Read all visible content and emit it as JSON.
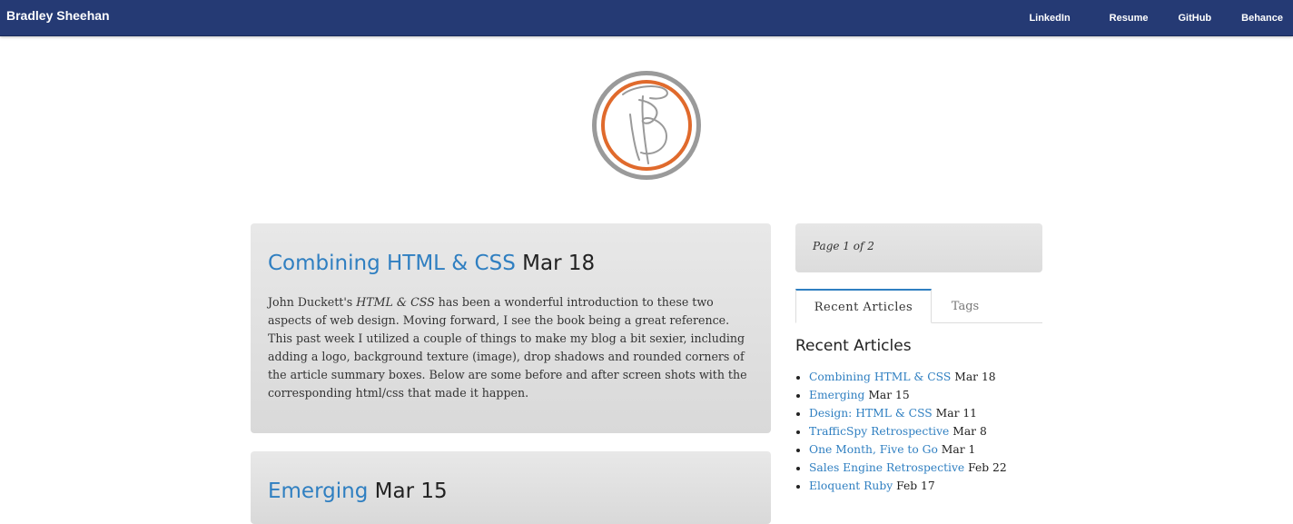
{
  "navbar": {
    "brand": "Bradley Sheehan",
    "links": [
      "LinkedIn",
      "Resume",
      "GitHub",
      "Behance"
    ]
  },
  "colors": {
    "navbar_bg": "#253a74",
    "link": "#2f7fc1",
    "logo_orange": "#e06a2c",
    "logo_gray": "#9a9a9a"
  },
  "logo": {
    "icon": "bs-monogram-logo"
  },
  "posts": [
    {
      "title": "Combining HTML & CSS",
      "date": "Mar 18",
      "excerpt_before": "John Duckett's ",
      "excerpt_book": "HTML & CSS",
      "excerpt_after": " has been a wonderful introduction to these two aspects of web design. Moving forward, I see the book being a great reference. This past week I utilized a couple of things to make my blog a bit sexier, including adding a logo, background texture (image), drop shadows and rounded corners of the article summary boxes. Below are some before and after screen shots with the corresponding html/css that made it happen."
    },
    {
      "title": "Emerging",
      "date": "Mar 15"
    }
  ],
  "sidebar": {
    "pagination": "Page 1 of 2",
    "tabs": [
      "Recent Articles",
      "Tags"
    ],
    "heading": "Recent Articles",
    "recent": [
      {
        "title": "Combining HTML & CSS",
        "date": "Mar 18"
      },
      {
        "title": "Emerging",
        "date": "Mar 15"
      },
      {
        "title": "Design: HTML & CSS",
        "date": "Mar 11"
      },
      {
        "title": "TrafficSpy Retrospective",
        "date": "Mar 8"
      },
      {
        "title": "One Month, Five to Go",
        "date": "Mar 1"
      },
      {
        "title": "Sales Engine Retrospective",
        "date": "Feb 22"
      },
      {
        "title": "Eloquent Ruby",
        "date": "Feb 17"
      }
    ]
  }
}
